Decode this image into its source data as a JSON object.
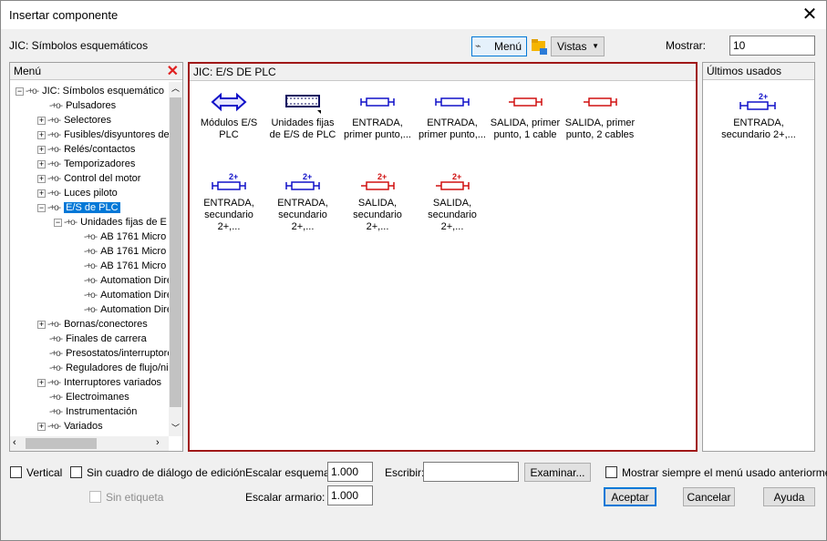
{
  "window": {
    "title": "Insertar componente"
  },
  "top": {
    "path_label": "JIC: Símbolos esquemáticos",
    "menu_btn": "Menú",
    "vistas_btn": "Vistas",
    "mostrar_label": "Mostrar:",
    "mostrar_value": "10"
  },
  "menu_panel": {
    "title": "Menú",
    "items": [
      {
        "label": "JIC: Símbolos esquemático",
        "expander": "−"
      },
      {
        "label": "Pulsadores",
        "expander": ""
      },
      {
        "label": "Selectores",
        "expander": "+"
      },
      {
        "label": "Fusibles/disyuntores de",
        "expander": "+"
      },
      {
        "label": "Relés/contactos",
        "expander": "+"
      },
      {
        "label": "Temporizadores",
        "expander": "+"
      },
      {
        "label": "Control del motor",
        "expander": "+"
      },
      {
        "label": "Luces piloto",
        "expander": "+"
      },
      {
        "label": "E/S de PLC",
        "expander": "−"
      },
      {
        "label": "Unidades fijas de E",
        "expander": "−"
      },
      {
        "label": "AB 1761 Micro",
        "expander": ""
      },
      {
        "label": "AB 1761 Micro",
        "expander": ""
      },
      {
        "label": "AB 1761 Micro",
        "expander": ""
      },
      {
        "label": "Automation Dire",
        "expander": ""
      },
      {
        "label": "Automation Dire",
        "expander": ""
      },
      {
        "label": "Automation Dire",
        "expander": ""
      },
      {
        "label": "Bornas/conectores",
        "expander": "+"
      },
      {
        "label": "Finales de carrera",
        "expander": ""
      },
      {
        "label": "Presostatos/interruptore",
        "expander": ""
      },
      {
        "label": "Reguladores de flujo/ni",
        "expander": ""
      },
      {
        "label": "Interruptores variados",
        "expander": "+"
      },
      {
        "label": "Electroimanes",
        "expander": ""
      },
      {
        "label": "Instrumentación",
        "expander": ""
      },
      {
        "label": "Variados",
        "expander": "+"
      }
    ]
  },
  "center_panel": {
    "title": "JIC: E/S DE PLC",
    "components": [
      {
        "line1": "Módulos E/S",
        "line2": "PLC"
      },
      {
        "line1": "Unidades fijas",
        "line2": "de E/S de PLC"
      },
      {
        "line1": "ENTRADA,",
        "line2": "primer punto,..."
      },
      {
        "line1": "ENTRADA,",
        "line2": "primer punto,..."
      },
      {
        "line1": "SALIDA, primer",
        "line2": "punto, 1 cable"
      },
      {
        "line1": "SALIDA, primer",
        "line2": "punto, 2 cables"
      },
      {
        "line1": "ENTRADA,",
        "line2": "secundario 2+,..."
      },
      {
        "line1": "ENTRADA,",
        "line2": "secundario 2+,..."
      },
      {
        "line1": "SALIDA,",
        "line2": "secundario 2+,..."
      },
      {
        "line1": "SALIDA,",
        "line2": "secundario 2+,..."
      }
    ],
    "badge": "2+"
  },
  "recent_panel": {
    "title": "Últimos usados",
    "item": {
      "line1": "ENTRADA,",
      "line2": "secundario 2+,..."
    }
  },
  "bottom": {
    "vertical": "Vertical",
    "sin_cuadro": "Sin cuadro de diálogo de edición",
    "sin_etiqueta": "Sin etiqueta",
    "escalar_esquema_label": "Escalar esquema:",
    "escalar_esquema_value": "1.000",
    "escalar_armario_label": "Escalar armario:",
    "escalar_armario_value": "1.000",
    "escribir_label": "Escribir:",
    "escribir_value": "",
    "examinar": "Examinar...",
    "mostrar_siempre": "Mostrar siempre el menú usado anteriormente",
    "aceptar": "Aceptar",
    "cancelar": "Cancelar",
    "ayuda": "Ayuda"
  },
  "colors": {
    "blue": "#1010c8",
    "red": "#d01010",
    "accent": "#0078d7",
    "frame_red": "#a01818"
  }
}
